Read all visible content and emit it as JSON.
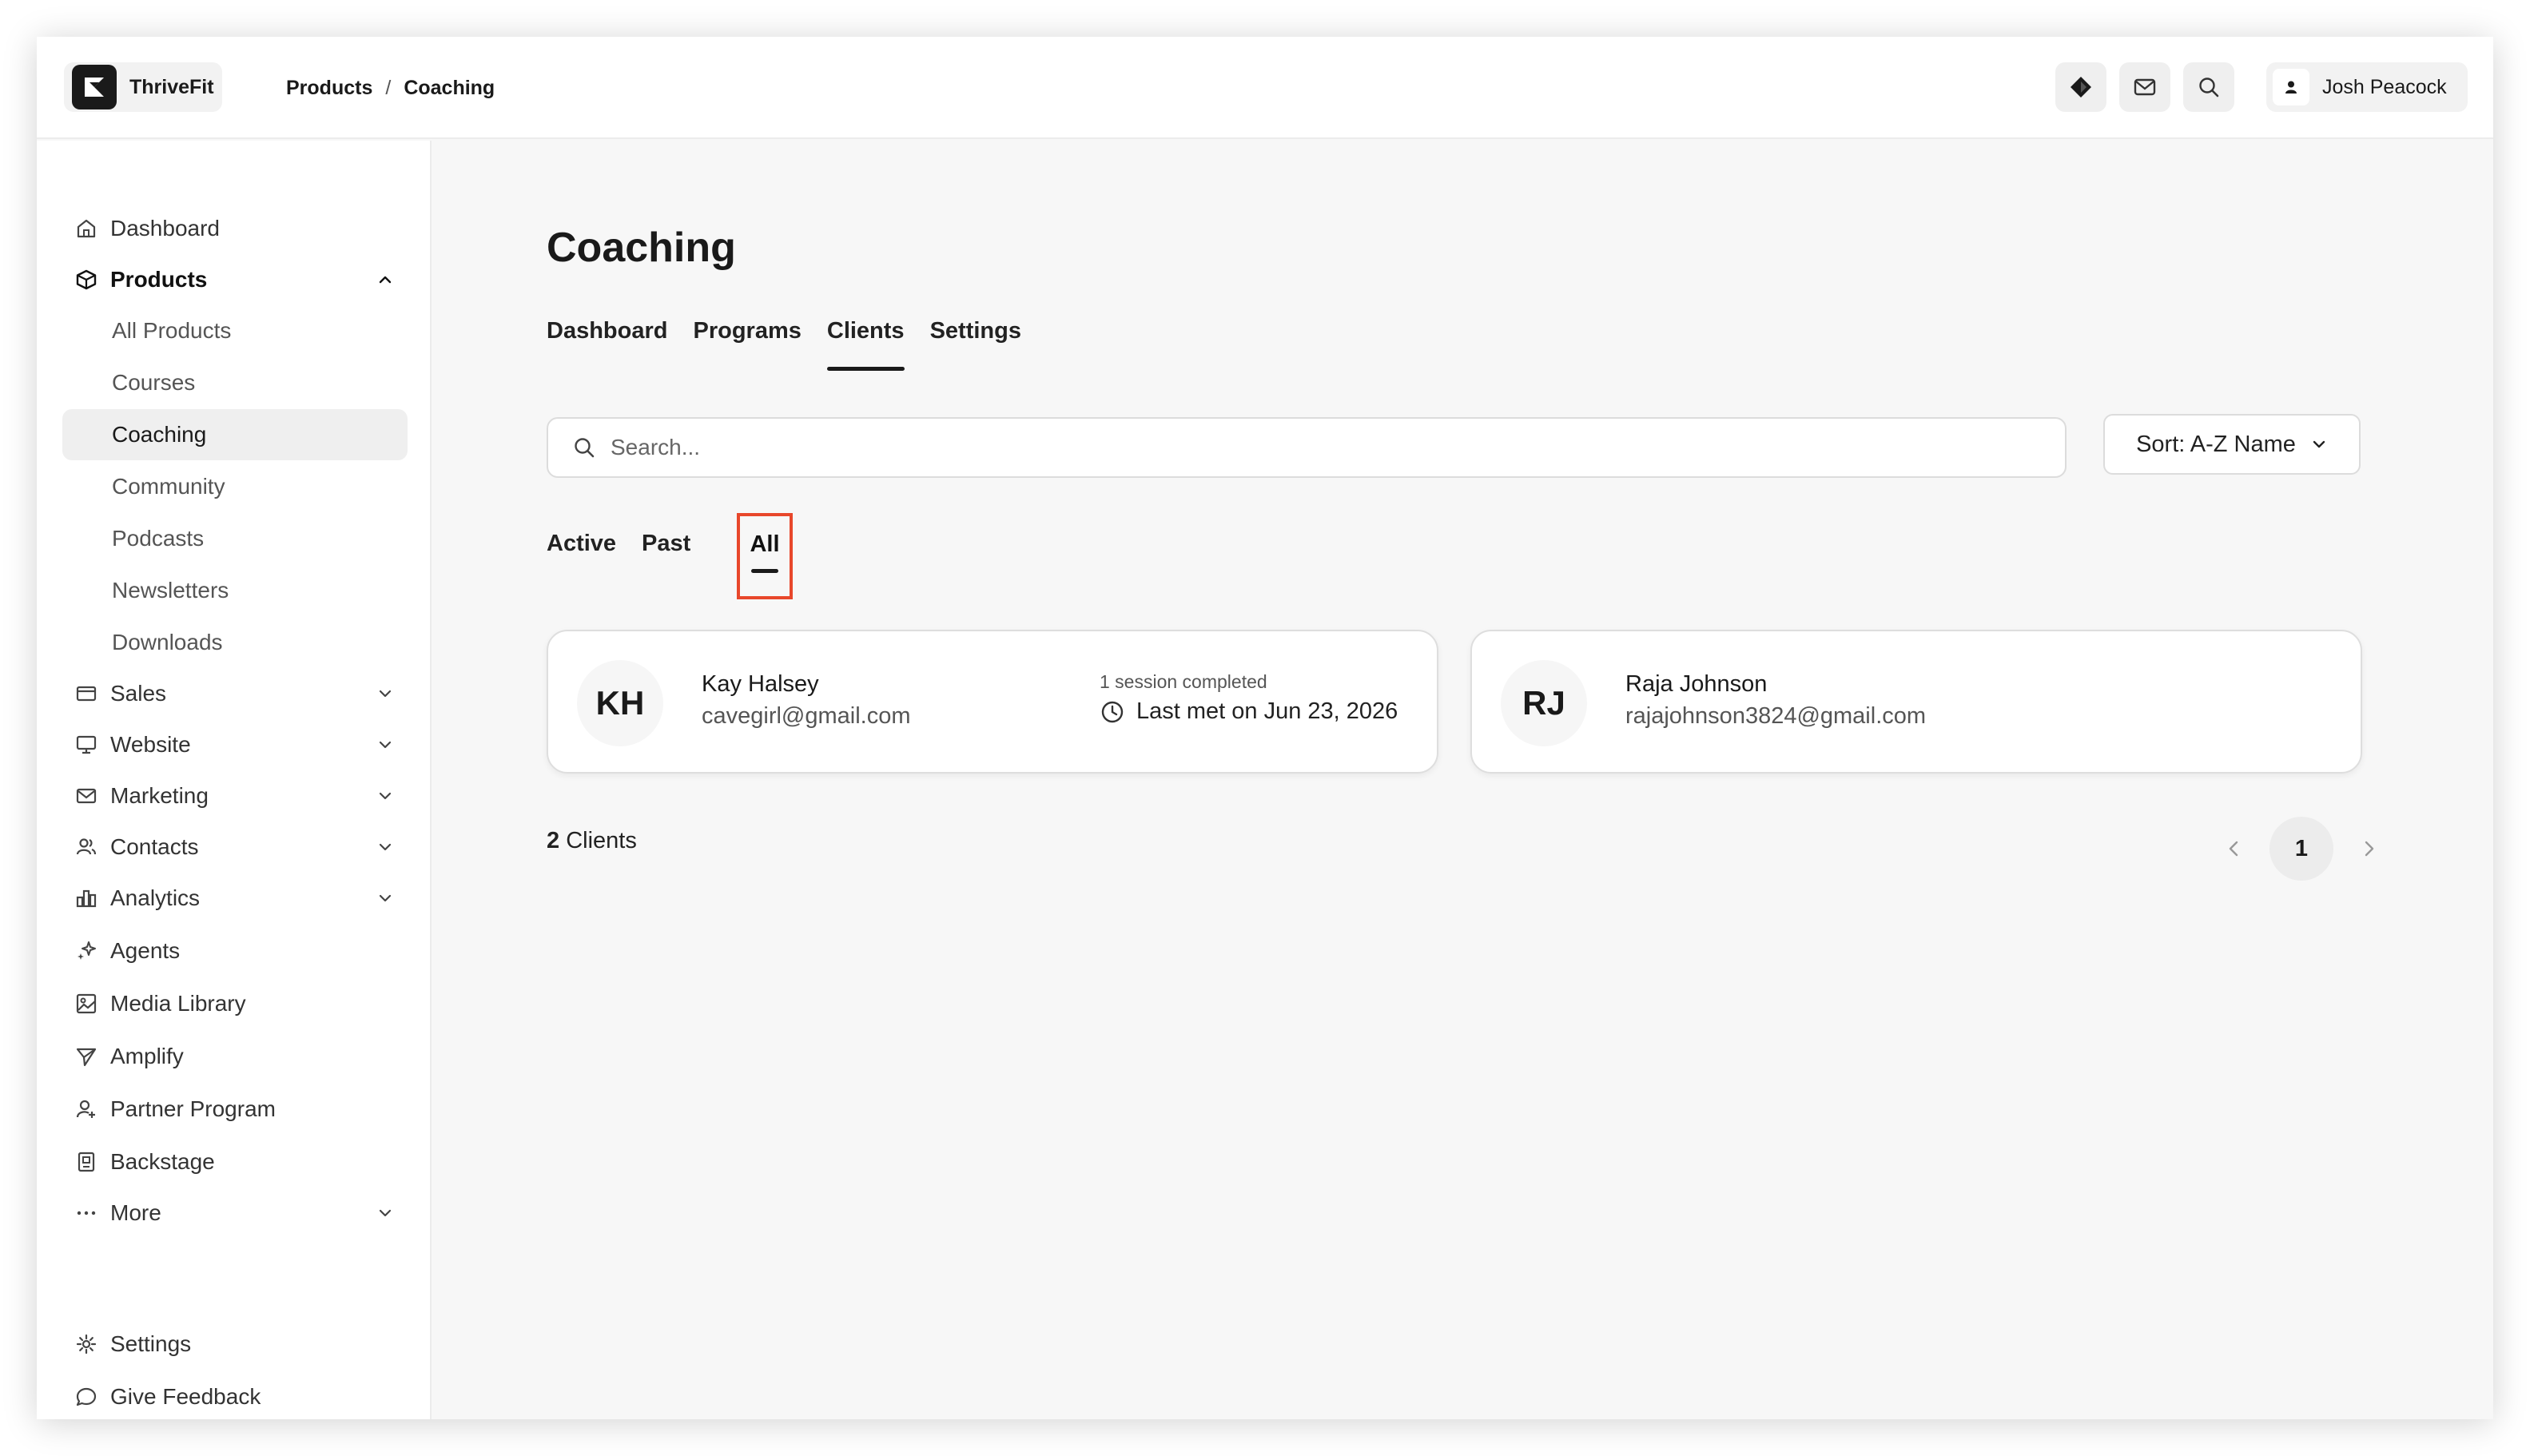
{
  "brand": {
    "name": "ThriveFit"
  },
  "breadcrumb": {
    "parent": "Products",
    "separator": "/",
    "current": "Coaching"
  },
  "user": {
    "name": "Josh Peacock"
  },
  "sidebar": {
    "top": [
      {
        "label": "Dashboard",
        "icon": "home-icon"
      },
      {
        "label": "Products",
        "icon": "box-icon",
        "expanded": true
      }
    ],
    "products_sub": [
      "All Products",
      "Courses",
      "Coaching",
      "Community",
      "Podcasts",
      "Newsletters",
      "Downloads"
    ],
    "active_sub": "Coaching",
    "groups": [
      {
        "label": "Sales",
        "icon": "card-icon"
      },
      {
        "label": "Website",
        "icon": "monitor-icon"
      },
      {
        "label": "Marketing",
        "icon": "mail-icon"
      },
      {
        "label": "Contacts",
        "icon": "users-icon"
      },
      {
        "label": "Analytics",
        "icon": "bar-chart-icon"
      }
    ],
    "items": [
      {
        "label": "Agents",
        "icon": "sparkle-icon"
      },
      {
        "label": "Media Library",
        "icon": "image-icon"
      },
      {
        "label": "Amplify",
        "icon": "send-icon"
      },
      {
        "label": "Partner Program",
        "icon": "partner-icon"
      },
      {
        "label": "Backstage",
        "icon": "badge-icon"
      },
      {
        "label": "More",
        "icon": "more-icon"
      }
    ],
    "bottom": [
      {
        "label": "Settings",
        "icon": "gear-icon"
      },
      {
        "label": "Give Feedback",
        "icon": "chat-icon"
      }
    ]
  },
  "main": {
    "title": "Coaching",
    "tabs": [
      "Dashboard",
      "Programs",
      "Clients",
      "Settings"
    ],
    "active_tab": "Clients",
    "search_placeholder": "Search...",
    "sort_label": "Sort: A-Z Name",
    "filters": [
      "Active",
      "Past",
      "All"
    ],
    "active_filter": "All",
    "clients": [
      {
        "initials": "KH",
        "name": "Kay Halsey",
        "email": "cavegirl@gmail.com",
        "sessions": "1 session completed",
        "last_met": "Last met on Jun 23, 2026"
      },
      {
        "initials": "RJ",
        "name": "Raja Johnson",
        "email": "rajajohnson3824@gmail.com"
      }
    ],
    "count": {
      "number": "2",
      "label": "Clients"
    },
    "pagination": {
      "current_page": "1"
    }
  }
}
